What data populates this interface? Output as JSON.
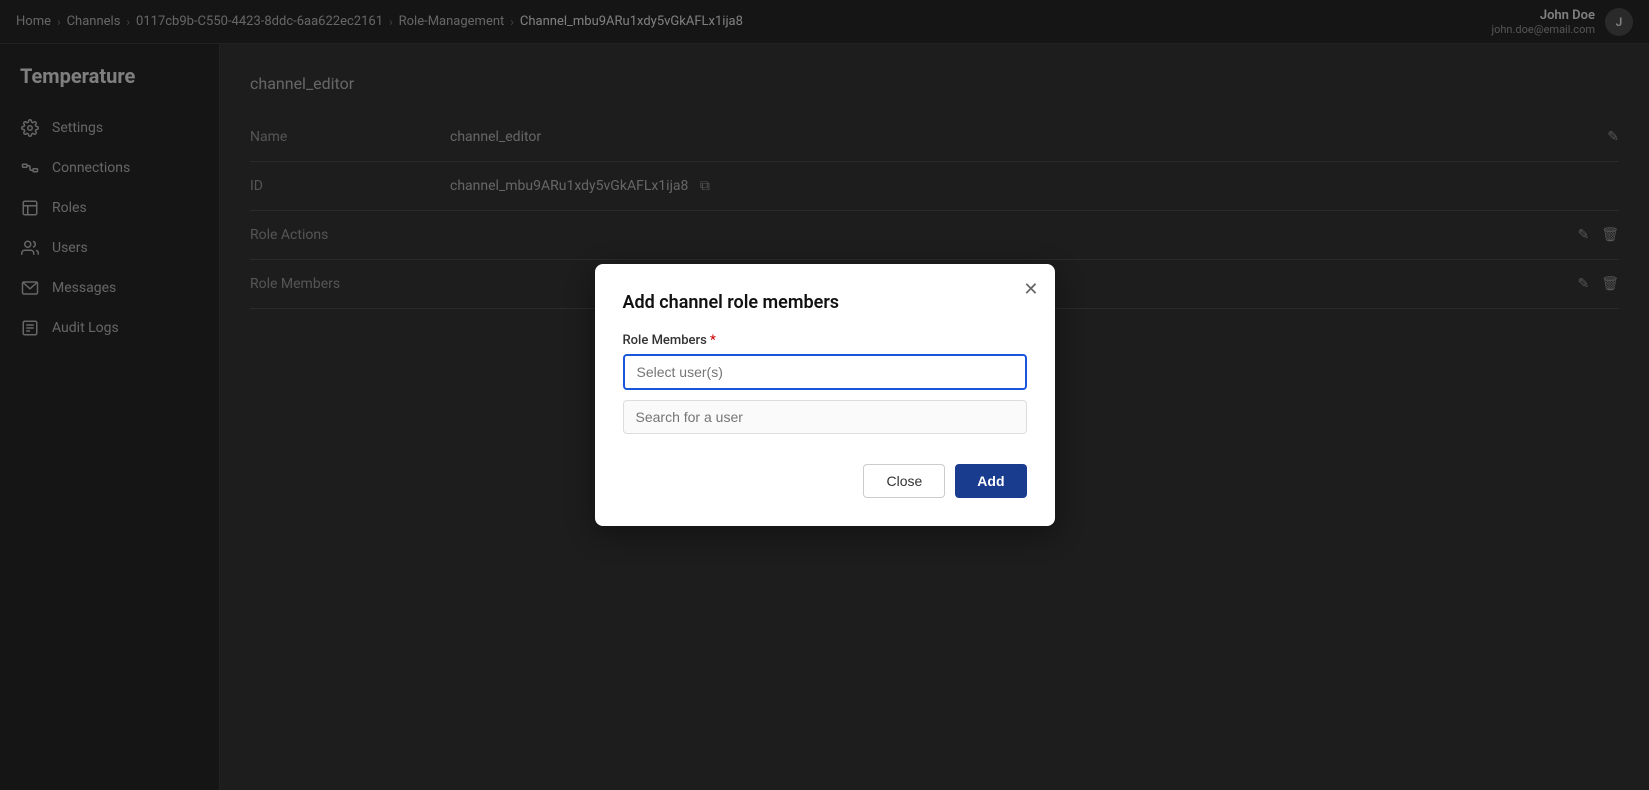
{
  "topNav": {
    "breadcrumbs": [
      {
        "label": "Home",
        "href": "#"
      },
      {
        "label": "Channels",
        "href": "#"
      },
      {
        "label": "0117cb9b-C550-4423-8ddc-6aa622ec2161",
        "href": "#"
      },
      {
        "label": "Role-Management",
        "href": "#"
      },
      {
        "label": "Channel_mbu9ARu1xdy5vGkAFLx1ija8",
        "href": "#",
        "current": true
      }
    ],
    "user": {
      "name": "John Doe",
      "email": "john.doe@email.com",
      "initials": "J"
    }
  },
  "sidebar": {
    "title": "Temperature",
    "items": [
      {
        "label": "Settings",
        "icon": "gear"
      },
      {
        "label": "Connections",
        "icon": "connections"
      },
      {
        "label": "Roles",
        "icon": "roles"
      },
      {
        "label": "Users",
        "icon": "users"
      },
      {
        "label": "Messages",
        "icon": "messages"
      },
      {
        "label": "Audit Logs",
        "icon": "audit"
      }
    ]
  },
  "content": {
    "roleHeader": "channel_editor",
    "rows": [
      {
        "label": "Name",
        "value": "channel_editor",
        "actions": [
          "edit"
        ]
      },
      {
        "label": "ID",
        "value": "channel_mbu9ARu1xdy5vGkAFLx1ija8",
        "actions": [
          "copy"
        ]
      },
      {
        "label": "Role Actions",
        "value": "",
        "actions": [
          "edit",
          "delete"
        ]
      },
      {
        "label": "Role Members",
        "value": "",
        "actions": [
          "edit",
          "delete"
        ]
      }
    ]
  },
  "modal": {
    "title": "Add channel role members",
    "roleMembers": {
      "label": "Role Members",
      "required": true,
      "selectPlaceholder": "Select user(s)",
      "searchPlaceholder": "Search for a user"
    },
    "buttons": {
      "close": "Close",
      "add": "Add"
    }
  }
}
